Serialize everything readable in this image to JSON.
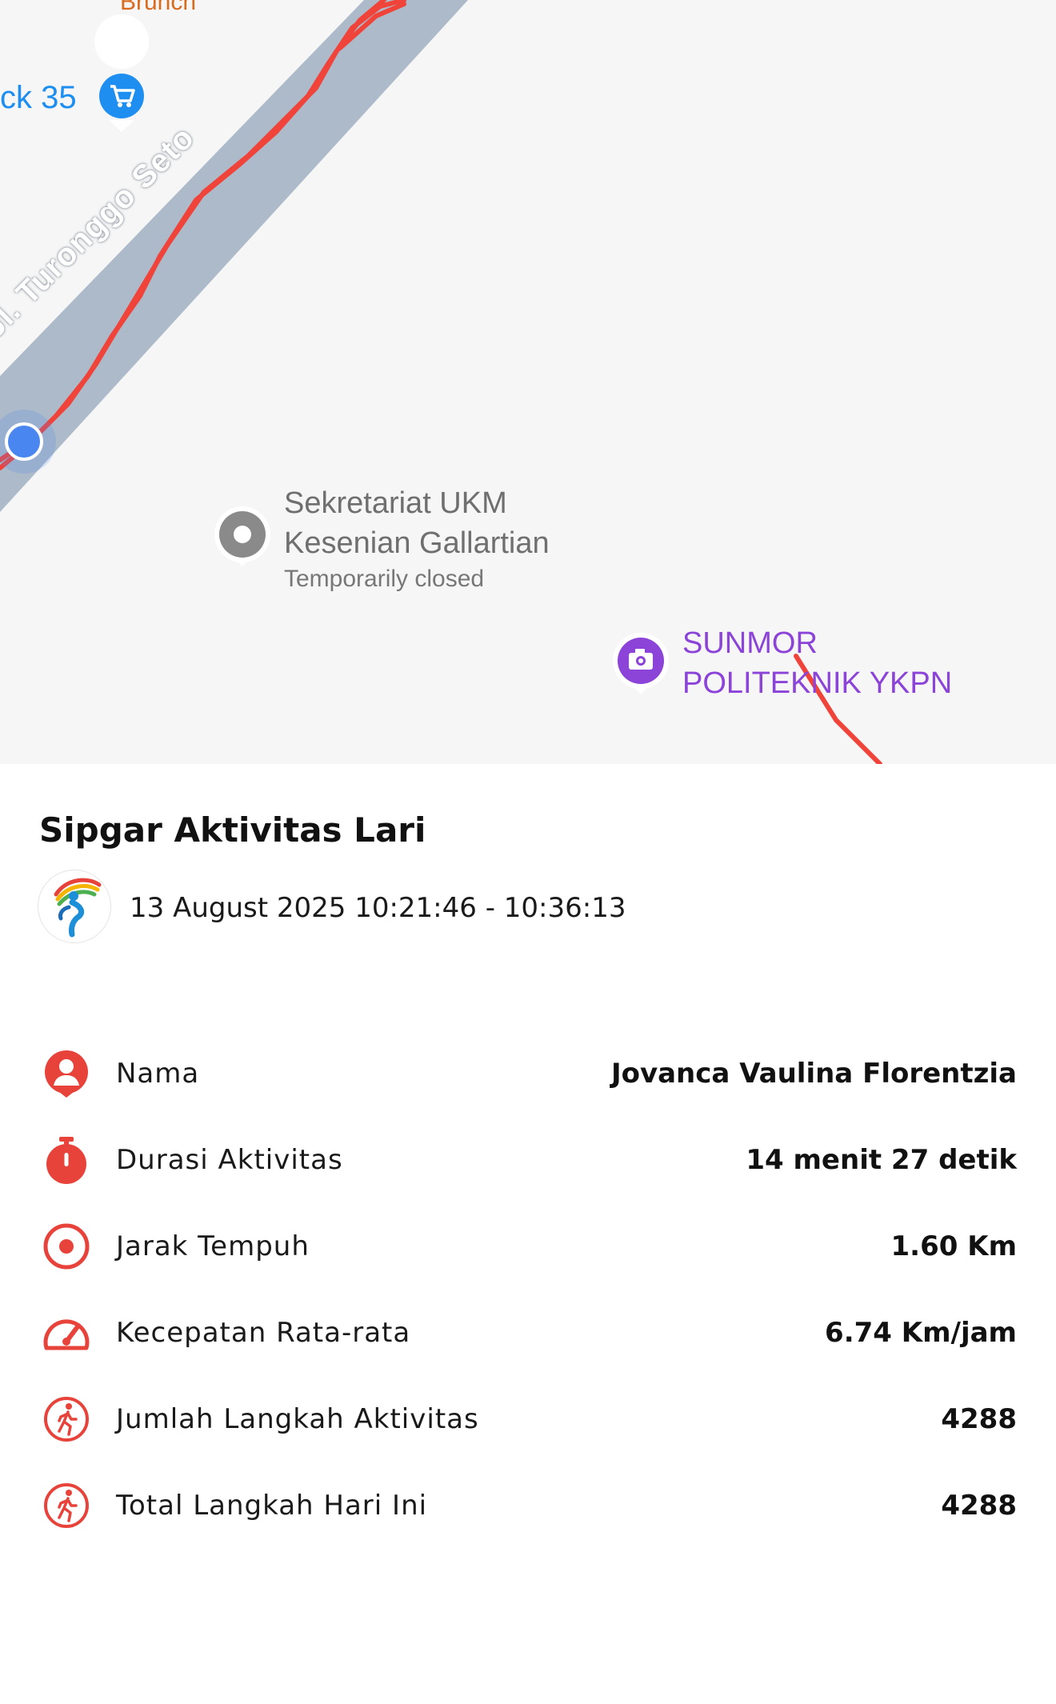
{
  "map": {
    "brunch_label": "Brunch",
    "shop_label": "ck 35",
    "road_label": "Jl. Turonggo Seto",
    "poi_secretariat": {
      "line1": "Sekretariat UKM",
      "line2": "Kesenian Gallartian",
      "status": "Temporarily closed"
    },
    "poi_sunmor": {
      "line1": "SUNMOR",
      "line2": "POLITEKNIK YKPN"
    },
    "colors": {
      "route": "#f0433a",
      "road": "#a9b6c6",
      "location": "#4a86f0",
      "poi_grey": "#8a8a8a",
      "poi_purple": "#8c44d8",
      "shop_blue": "#1e8ef0"
    }
  },
  "panel": {
    "title": "Sipgar Aktivitas Lari",
    "datetime": "13 August 2025 10:21:46 - 10:36:13",
    "accent_color": "#e8433a",
    "stats": [
      {
        "icon": "user-icon",
        "label": "Nama",
        "value": "Jovanca Vaulina Florentzia"
      },
      {
        "icon": "stopwatch-icon",
        "label": "Durasi Aktivitas",
        "value": "14 menit 27 detik"
      },
      {
        "icon": "target-icon",
        "label": "Jarak Tempuh",
        "value": "1.60 Km"
      },
      {
        "icon": "speedometer-icon",
        "label": "Kecepatan Rata-rata",
        "value": "6.74 Km/jam"
      },
      {
        "icon": "runner-icon",
        "label": "Jumlah Langkah Aktivitas",
        "value": "4288"
      },
      {
        "icon": "runner-icon",
        "label": "Total Langkah Hari Ini",
        "value": "4288"
      }
    ]
  }
}
